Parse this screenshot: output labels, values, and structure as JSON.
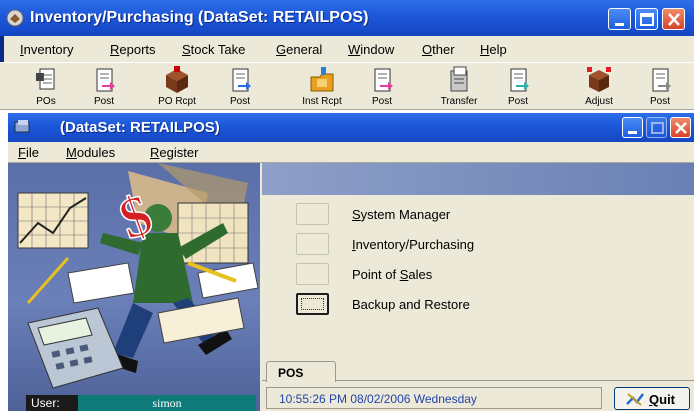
{
  "outer_window": {
    "title": "Inventory/Purchasing  (DataSet: RETAILPOS)",
    "icon": "app-icon",
    "menu": [
      "Inventory",
      "Reports",
      "Stock Take",
      "General",
      "Window",
      "Other",
      "Help"
    ]
  },
  "toolbar": {
    "buttons": [
      {
        "label": "POs",
        "icon": "document-pos-icon"
      },
      {
        "label": "Post",
        "icon": "post-document-icon"
      },
      {
        "label": "PO Rcpt",
        "icon": "box-receipt-icon"
      },
      {
        "label": "Post",
        "icon": "post-document-icon"
      },
      {
        "label": "Inst Rcpt",
        "icon": "folder-receipt-icon"
      },
      {
        "label": "Post",
        "icon": "post-document-icon"
      },
      {
        "label": "Transfer",
        "icon": "transfer-icon"
      },
      {
        "label": "Post",
        "icon": "post-document-icon"
      },
      {
        "label": "Adjust",
        "icon": "adjust-box-icon"
      },
      {
        "label": "Post",
        "icon": "post-document-icon"
      }
    ]
  },
  "inner_window": {
    "title": "(DataSet: RETAILPOS)",
    "menu": [
      "File",
      "Modules",
      "Register"
    ]
  },
  "modules": [
    {
      "label_prefix": "",
      "hotkey": "S",
      "label_rest": "ystem Manager"
    },
    {
      "label_prefix": "",
      "hotkey": "I",
      "label_rest": "nventory/Purchasing"
    },
    {
      "label_prefix": "Point of ",
      "hotkey": "S",
      "label_rest": "ales"
    },
    {
      "label_prefix": "Backup and Restore",
      "hotkey": "",
      "label_rest": ""
    }
  ],
  "user": {
    "label": "User:",
    "name": "simon"
  },
  "tab": {
    "label": "POS"
  },
  "status": {
    "datetime": "10:55:26 PM  08/02/2006  Wednesday"
  },
  "quit": {
    "label": "Quit"
  }
}
